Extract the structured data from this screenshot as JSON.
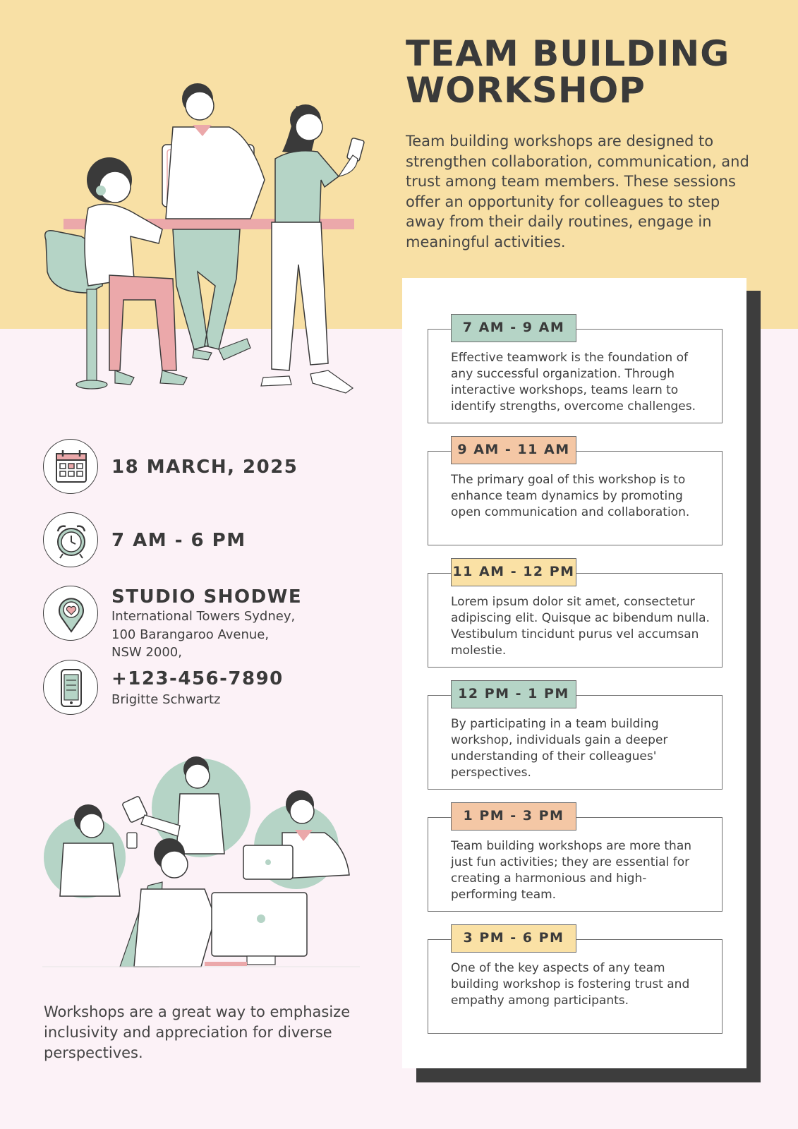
{
  "header": {
    "title_line1": "TEAM BUILDING",
    "title_line2": "WORKSHOP",
    "intro": "Team building workshops are designed to strengthen collaboration, communication, and trust among team members. These sessions offer an opportunity for colleagues to step away from their daily routines, engage in meaningful activities."
  },
  "info": {
    "date": "18 MARCH, 2025",
    "time": "7 AM - 6 PM",
    "venue_name": "STUDIO SHODWE",
    "address_line1": "International Towers Sydney,",
    "address_line2": "100 Barangaroo Avenue,",
    "address_line3": "NSW 2000,",
    "phone": "+123-456-7890",
    "contact_name": "Brigitte Schwartz"
  },
  "icons": {
    "date": "calendar-icon",
    "time": "alarm-clock-icon",
    "venue": "location-pin-icon",
    "phone": "phone-icon"
  },
  "schedule": [
    {
      "time": "7 AM - 9 AM",
      "color": "#b5d4c6",
      "text": "Effective teamwork is the foundation of any successful organization. Through interactive workshops, teams learn to identify strengths, overcome challenges."
    },
    {
      "time": "9 AM - 11 AM",
      "color": "#f4c7a5",
      "text": "The primary goal of this workshop is to enhance team dynamics by promoting open communication and collaboration."
    },
    {
      "time": "11 AM - 12 PM",
      "color": "#fae1a5",
      "text": "Lorem ipsum dolor sit amet, consectetur adipiscing elit. Quisque ac bibendum nulla. Vestibulum tincidunt purus vel accumsan molestie."
    },
    {
      "time": "12 PM - 1 PM",
      "color": "#b5d4c6",
      "text": "By participating in a team building workshop, individuals gain a deeper understanding of their colleagues' perspectives."
    },
    {
      "time": "1 PM - 3 PM",
      "color": "#f4c7a5",
      "text": "Team building workshops are more than just fun activities; they are essential for creating a harmonious and high-performing team."
    },
    {
      "time": "3 PM - 6 PM",
      "color": "#fae1a5",
      "text": "One of the key aspects of any team building workshop is fostering trust and empathy among participants."
    }
  ],
  "footer": {
    "text": "Workshops are a great way to emphasize inclusivity and appreciation for diverse perspectives."
  },
  "colors": {
    "top_band": "#f8e0a5",
    "background": "#fcf2f7",
    "mint": "#b5d4c6",
    "peach": "#f4c7a5",
    "pink": "#eba8aa",
    "dark": "#3a3a3a"
  }
}
